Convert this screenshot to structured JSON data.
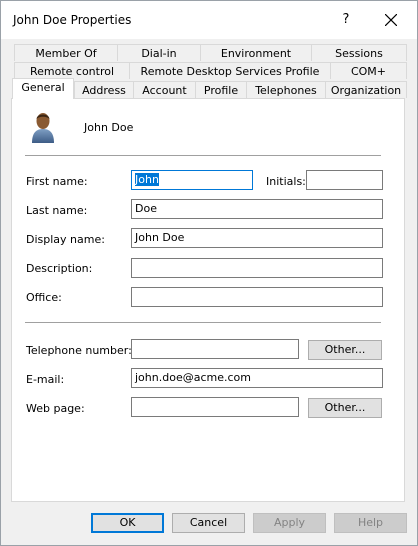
{
  "window": {
    "title": "John Doe Properties",
    "help_label": "?"
  },
  "tabs": {
    "row1": [
      "Member Of",
      "Dial-in",
      "Environment",
      "Sessions"
    ],
    "row2": [
      "Remote control",
      "Remote Desktop Services Profile",
      "COM+"
    ],
    "row3": [
      "General",
      "Address",
      "Account",
      "Profile",
      "Telephones",
      "Organization"
    ],
    "active": "General"
  },
  "user": {
    "display": "John Doe"
  },
  "form": {
    "first_name_label": "First name:",
    "first_name_value": "John",
    "initials_label": "Initials:",
    "initials_value": "",
    "last_name_label": "Last name:",
    "last_name_value": "Doe",
    "display_name_label": "Display name:",
    "display_name_value": "John Doe",
    "description_label": "Description:",
    "description_value": "",
    "office_label": "Office:",
    "office_value": "",
    "telephone_label": "Telephone number:",
    "telephone_value": "",
    "telephone_other": "Other...",
    "email_label": "E-mail:",
    "email_value": "john.doe@acme.com",
    "webpage_label": "Web page:",
    "webpage_value": "",
    "webpage_other": "Other..."
  },
  "buttons": {
    "ok": "OK",
    "cancel": "Cancel",
    "apply": "Apply",
    "help": "Help"
  },
  "colors": {
    "accent": "#0078d7",
    "panel": "#ffffff",
    "chrome": "#f0f0f0"
  },
  "icons": {
    "avatar": "user-avatar-icon",
    "close": "close-icon"
  }
}
